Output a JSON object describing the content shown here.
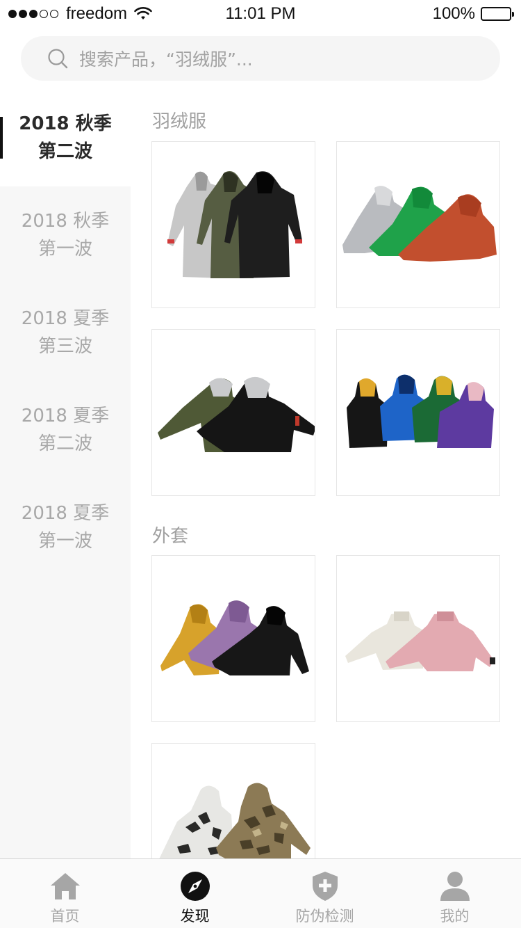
{
  "status_bar": {
    "carrier": "freedom",
    "time": "11:01 PM",
    "battery": "100%"
  },
  "search": {
    "placeholder": "搜索产品，“羽绒服”..."
  },
  "sidebar": {
    "items": [
      {
        "line1": "2018 秋季",
        "line2": "第二波",
        "active": true
      },
      {
        "line1": "2018 秋季",
        "line2": "第一波",
        "active": false
      },
      {
        "line1": "2018 夏季",
        "line2": "第三波",
        "active": false
      },
      {
        "line1": "2018 夏季",
        "line2": "第二波",
        "active": false
      },
      {
        "line1": "2018 夏季",
        "line2": "第一波",
        "active": false
      }
    ]
  },
  "sections": [
    {
      "title": "羽绒服",
      "products": [
        {
          "image": "long-parkas-gray-olive-black"
        },
        {
          "image": "hooded-puffers-gray-green-orange"
        },
        {
          "image": "puffers-olive-black-gray-hood"
        },
        {
          "image": "hooded-puffers-black-blue-green-purple"
        }
      ]
    },
    {
      "title": "外套",
      "products": [
        {
          "image": "hooded-jackets-yellow-purple-black"
        },
        {
          "image": "collar-jackets-cream-pink"
        },
        {
          "image": "camo-hooded-jackets"
        }
      ]
    }
  ],
  "tabbar": {
    "tabs": [
      {
        "label": "首页",
        "icon": "home-icon",
        "active": false
      },
      {
        "label": "发现",
        "icon": "compass-icon",
        "active": true
      },
      {
        "label": "防伪检测",
        "icon": "shield-plus-icon",
        "active": false
      },
      {
        "label": "我的",
        "icon": "user-icon",
        "active": false
      }
    ]
  }
}
